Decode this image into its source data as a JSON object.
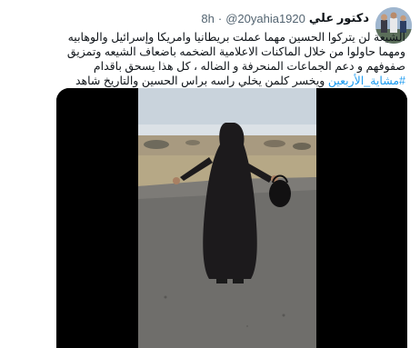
{
  "tweet": {
    "display_name": "دكتور علي",
    "handle": "@20yahia1920",
    "separator": "·",
    "time": "8h",
    "more_icon": "ellipsis-icon",
    "text_part1": "الشيعة لن يتركوا الحسين مهما عملت بريطانيا وامريكا وإسرائيل والوهابيه ومهما حاولوا من خلال الماكنات الاعلامية الضخمه باضعاف الشيعه وتمزيق صفوفهم و دعم الجماعات المنحرفة و الضاله ، كل هذا يسحق باقدام ",
    "hashtag": "#مشاية_الأربعين",
    "text_part2": "  ويخسر كلمن يخلي راسه براس الحسين والتاريخ شاهد على هذا",
    "media_icon": "video-thumbnail"
  }
}
